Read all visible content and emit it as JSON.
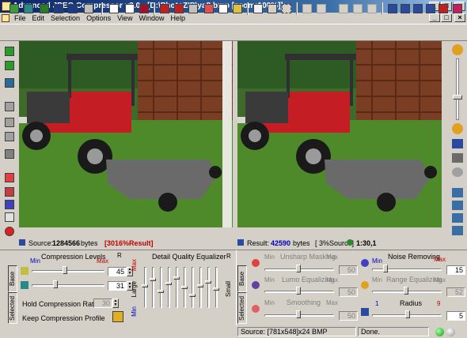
{
  "window": {
    "title": "Advanced JPEG Compressor v3.0 - [D:\\PhotoZIP\\ya8.bmp  [zoom:100%]]"
  },
  "menu": [
    "File",
    "Edit",
    "Selection",
    "Options",
    "View",
    "Window",
    "Help"
  ],
  "colors": {
    "title_start": "#0a246a",
    "title_end": "#a6caf0",
    "accent_red": "#c00000",
    "accent_blue": "#0000c0",
    "grass": "#4f8a2a"
  },
  "source_bar": {
    "label": "Source:",
    "bytes": "1284566",
    "unit": "bytes",
    "percent": "[3016%Result]"
  },
  "result_bar": {
    "label": "Result:",
    "bytes": "42590",
    "unit": "bytes",
    "percent": "[ 3%Source]",
    "ratio": "1:30,1"
  },
  "compression": {
    "tab_base": "Base",
    "tab_selected": "Selected",
    "title": "Compression Levels",
    "r_label": "R",
    "min": "Min",
    "max": "Max",
    "level1": "45",
    "level2": "31",
    "level1_fraction": 0.45,
    "level2_fraction": 0.31,
    "hold_label": "Hold Compression Ratio",
    "hold_value": "30",
    "keep_label": "Keep Compression Profile"
  },
  "equalizer": {
    "title": "Detail Quality Equalizer",
    "left_top": "Max",
    "left_mid": "Large",
    "left_bottom": "Min",
    "right_mid": "Small",
    "right_top": "R",
    "levels": [
      0.55,
      0.7,
      0.4,
      0.6,
      0.75,
      0.5,
      0.3,
      0.55,
      0.65,
      0.45
    ]
  },
  "filters": {
    "tab_base": "Base",
    "tab_selected": "Selected",
    "unsharp": {
      "label": "Unsharp Masking",
      "min": "Min",
      "max": "Max",
      "value": "50"
    },
    "lumo": {
      "label": "Lumo Equalizing",
      "min": "Min",
      "max": "Max",
      "value": "50"
    },
    "smoothing": {
      "label": "Smoothing",
      "min": "Min",
      "max": "Max",
      "value": "50"
    },
    "noise": {
      "label": "Noise Removing",
      "min": "Min",
      "max": "Max",
      "value": "15"
    },
    "range": {
      "label": "Range Equalizing",
      "min": "Min",
      "max": "Max",
      "value": "52"
    },
    "radius": {
      "label": "Radius",
      "min": "1",
      "max": "9",
      "value": "5"
    }
  },
  "status": {
    "source": "Source: [781x548]x24 BMP",
    "state": "Done."
  }
}
